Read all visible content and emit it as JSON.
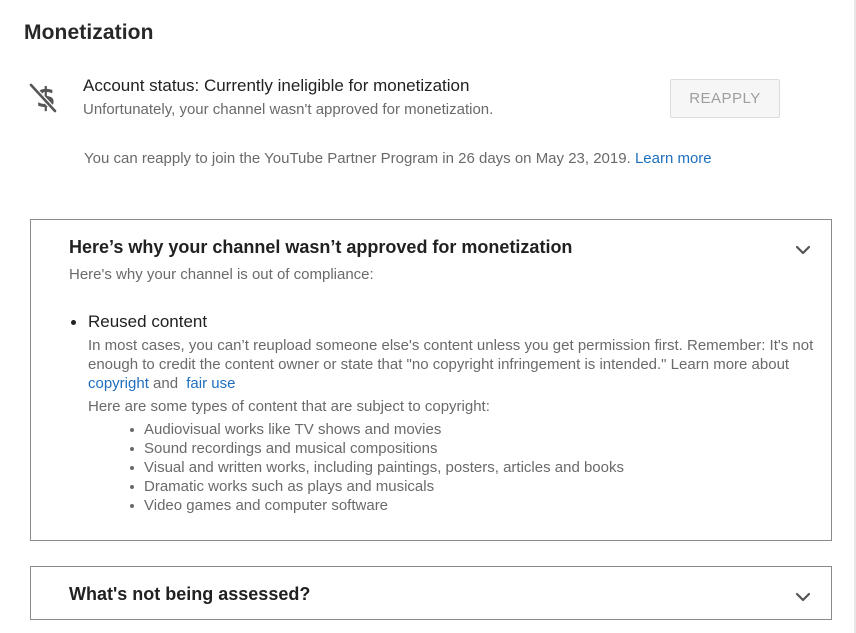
{
  "page": {
    "title": "Monetization"
  },
  "status": {
    "icon": "no-money-icon",
    "title": "Account status: Currently ineligible for monetization",
    "subtitle": "Unfortunately, your channel wasn't approved for monetization.",
    "reapply_label": "REAPPLY",
    "reapply_note": "You can reapply to join the YouTube Partner Program in 26 days on May 23, 2019.",
    "learn_more": "Learn more"
  },
  "panel_reasons": {
    "title": "Here’s why your channel wasn’t approved for monetization",
    "subtitle": "Here's why your channel is out of compliance:",
    "reason": {
      "title": "Reused content",
      "body_prefix": "In most cases, you can’t reupload someone else's content unless you get permission first. Remember: It's not enough to credit the content owner or state that \"no copyright infringement is intended.\" Learn more about",
      "link_copyright": "copyright",
      "and_text": "and",
      "link_fair_use": "fair use",
      "types_intro": "Here are some types of content that are subject to copyright:",
      "types": [
        "Audiovisual works like TV shows and movies",
        "Sound recordings and musical compositions",
        "Visual and written works, including paintings, posters, articles and books",
        "Dramatic works such as plays and musicals",
        "Video games and computer software"
      ]
    }
  },
  "panel_not_assessed": {
    "title": "What's not being assessed?"
  },
  "colors": {
    "link": "#1f6fbf",
    "muted_text": "#6a6a6a",
    "panel_border": "#8a8a8a"
  }
}
